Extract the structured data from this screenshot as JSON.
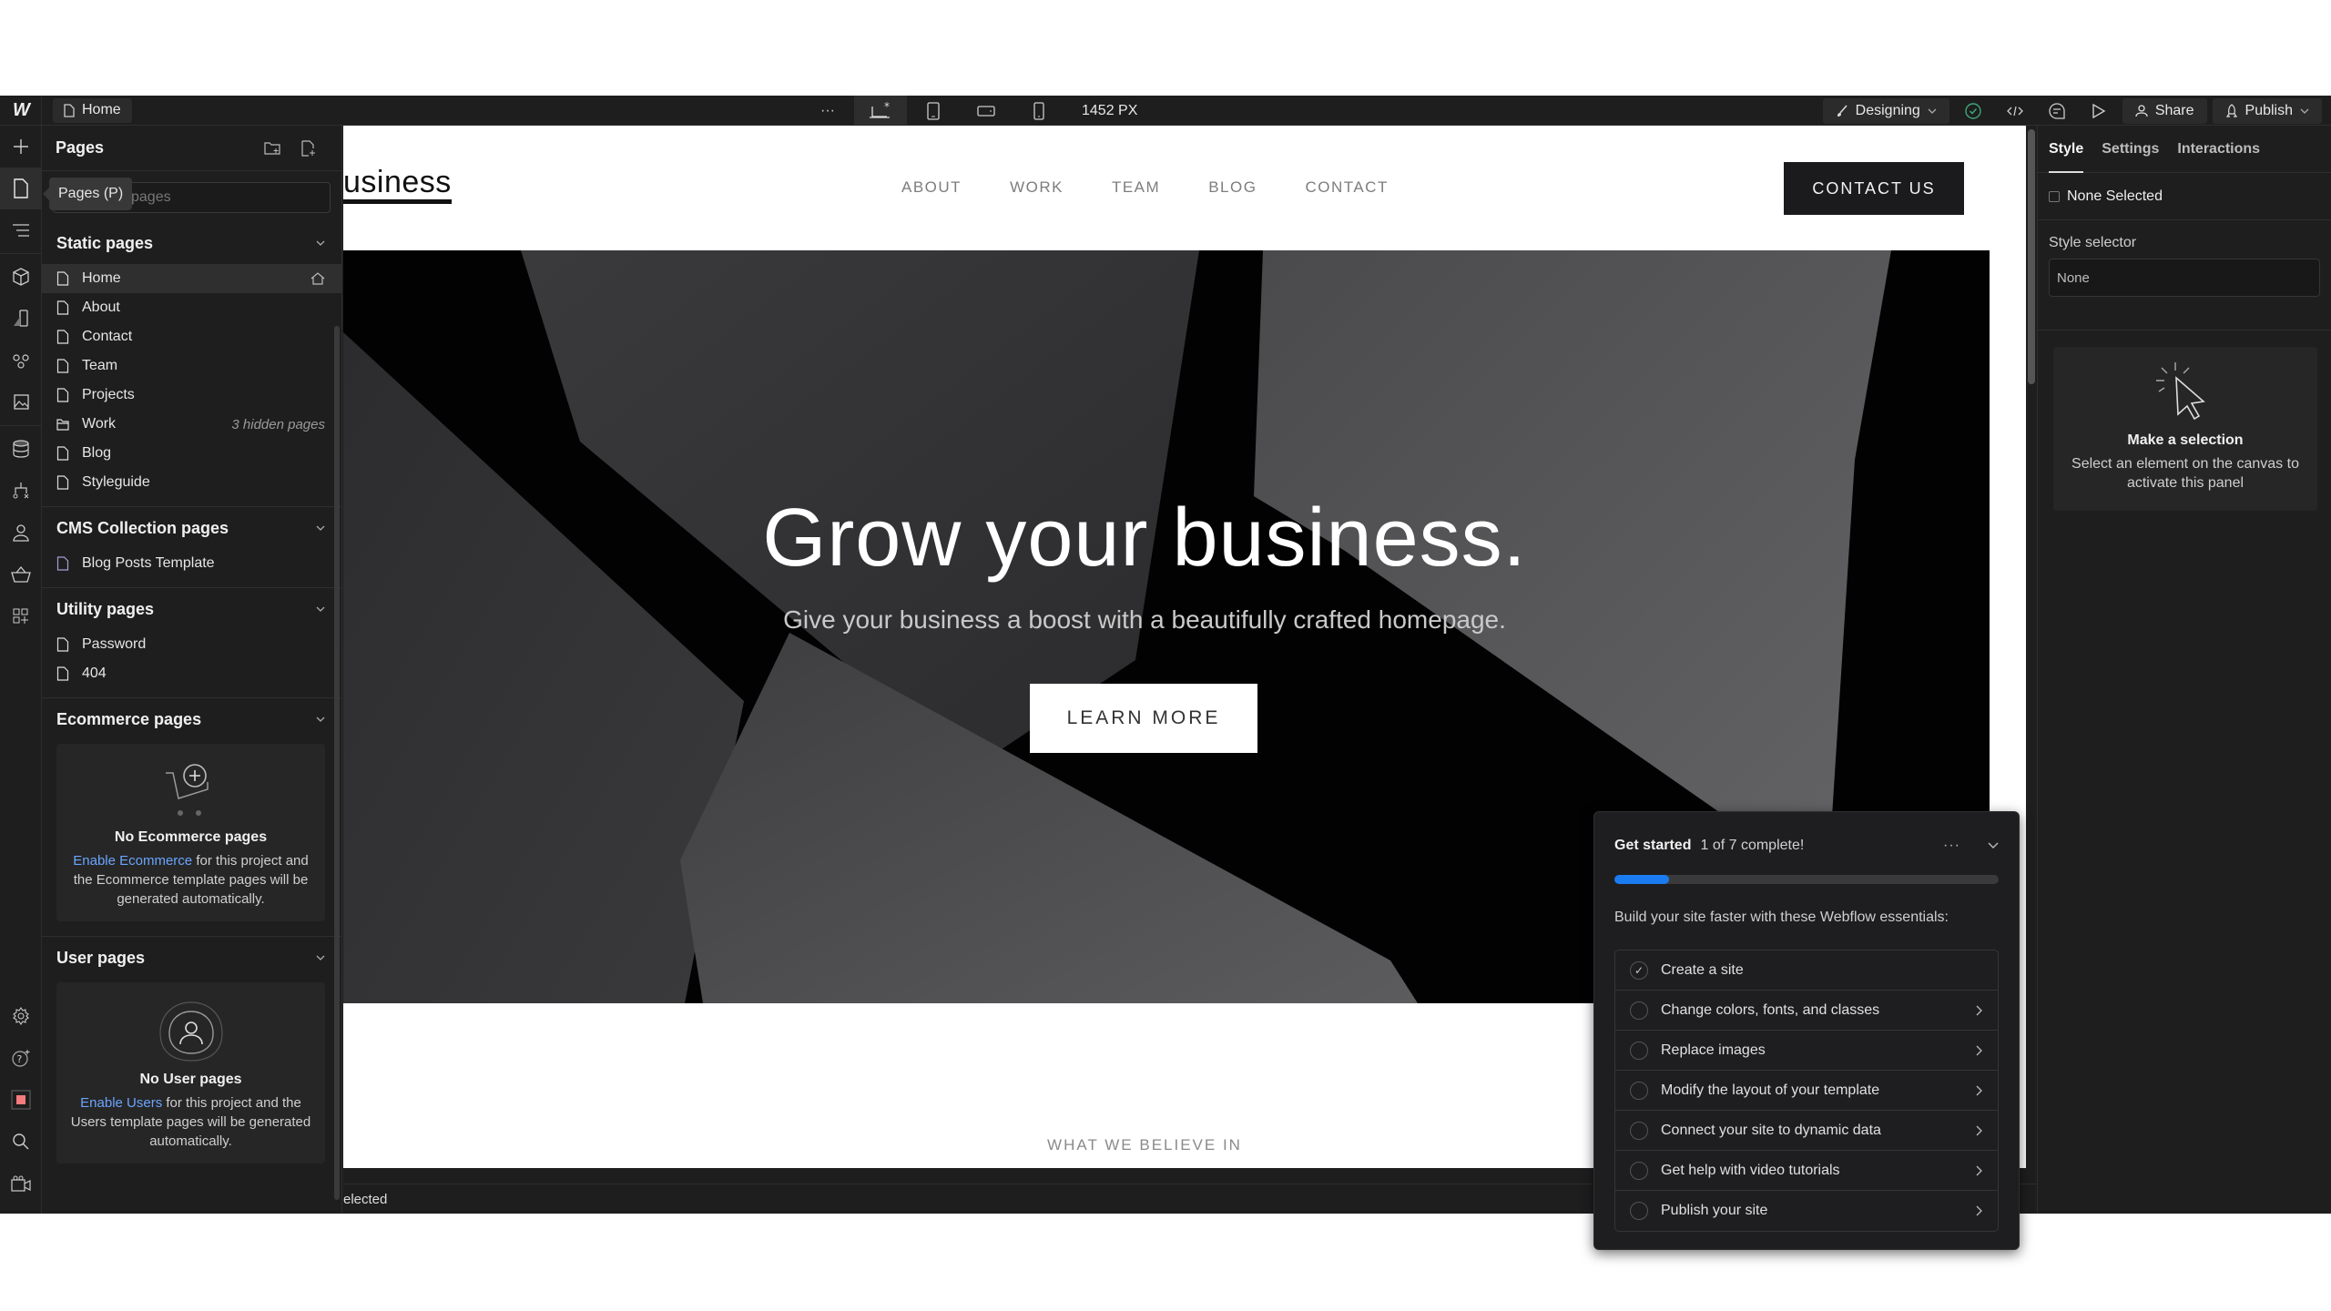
{
  "topbar": {
    "logo": "W",
    "current_page": "Home",
    "more": "···",
    "breakpoint_width": "1452 PX",
    "mode": "Designing",
    "share": "Share",
    "publish": "Publish",
    "icons": [
      "desktop-star-icon",
      "tablet-icon",
      "mobile-landscape-icon",
      "mobile-portrait-icon",
      "check-status-icon",
      "code-icon",
      "comment-icon",
      "preview-play-icon"
    ]
  },
  "rail": {
    "top": [
      "add-icon",
      "pages-icon",
      "navigator-icon"
    ],
    "middle": [
      "components-icon",
      "variables-icon",
      "styles-icon",
      "assets-icon"
    ],
    "lower": [
      "cms-icon",
      "logic-icon",
      "users-icon",
      "ecommerce-icon",
      "apps-icon"
    ],
    "bottom": [
      "settings-icon",
      "help-icon",
      "record-icon",
      "search-icon",
      "video-icon"
    ]
  },
  "pages_panel": {
    "title": "Pages",
    "tooltip": "Pages (P)",
    "search_placeholder": "Search pages",
    "search_visible_text": "pages",
    "sections": {
      "static": {
        "title": "Static pages",
        "items": [
          {
            "label": "Home",
            "icon": "page-icon",
            "badge": "home-icon"
          },
          {
            "label": "About",
            "icon": "page-icon"
          },
          {
            "label": "Contact",
            "icon": "page-icon"
          },
          {
            "label": "Team",
            "icon": "page-icon"
          },
          {
            "label": "Projects",
            "icon": "page-icon"
          },
          {
            "label": "Work",
            "icon": "folder-icon",
            "hint": "3 hidden pages"
          },
          {
            "label": "Blog",
            "icon": "page-icon"
          },
          {
            "label": "Styleguide",
            "icon": "page-icon"
          }
        ]
      },
      "cms": {
        "title": "CMS Collection pages",
        "items": [
          {
            "label": "Blog Posts Template",
            "icon": "cms-page-icon"
          }
        ]
      },
      "utility": {
        "title": "Utility pages",
        "items": [
          {
            "label": "Password",
            "icon": "page-icon"
          },
          {
            "label": "404",
            "icon": "page-icon"
          }
        ]
      },
      "ecommerce": {
        "title": "Ecommerce pages",
        "empty_title": "No Ecommerce pages",
        "link": "Enable Ecommerce",
        "text": " for this project and the Ecommerce template pages will be generated automatically."
      },
      "users": {
        "title": "User pages",
        "empty_title": "No User pages",
        "link": "Enable Users",
        "text": " for this project and the Users template pages will be generated automatically."
      }
    }
  },
  "canvas": {
    "logo_text": "usiness",
    "nav": [
      "ABOUT",
      "WORK",
      "TEAM",
      "BLOG",
      "CONTACT"
    ],
    "contact_button": "CONTACT US",
    "hero_title": "Grow your business.",
    "hero_subtitle": "Give your business a boost with a beautifully crafted homepage.",
    "hero_button": "LEARN MORE",
    "section_label": "WHAT WE BELIEVE IN",
    "status_text": "elected"
  },
  "get_started": {
    "title": "Get started",
    "count": "1 of 7 complete!",
    "progress": 0.1428,
    "progress_color": "#1a7cf0",
    "description": "Build your site faster with these Webflow essentials:",
    "items": [
      {
        "label": "Create a site",
        "done": true
      },
      {
        "label": "Change colors, fonts, and classes",
        "done": false
      },
      {
        "label": "Replace images",
        "done": false
      },
      {
        "label": "Modify the layout of your template",
        "done": false
      },
      {
        "label": "Connect your site to dynamic data",
        "done": false
      },
      {
        "label": "Get help with video tutorials",
        "done": false
      },
      {
        "label": "Publish your site",
        "done": false
      }
    ]
  },
  "right_panel": {
    "tabs": [
      "Style",
      "Settings",
      "Interactions"
    ],
    "active_tab": "Style",
    "none_selected": "None Selected",
    "style_selector_label": "Style selector",
    "style_selector_value": "None",
    "empty_title": "Make a selection",
    "empty_text": "Select an element on the canvas to activate this panel"
  }
}
